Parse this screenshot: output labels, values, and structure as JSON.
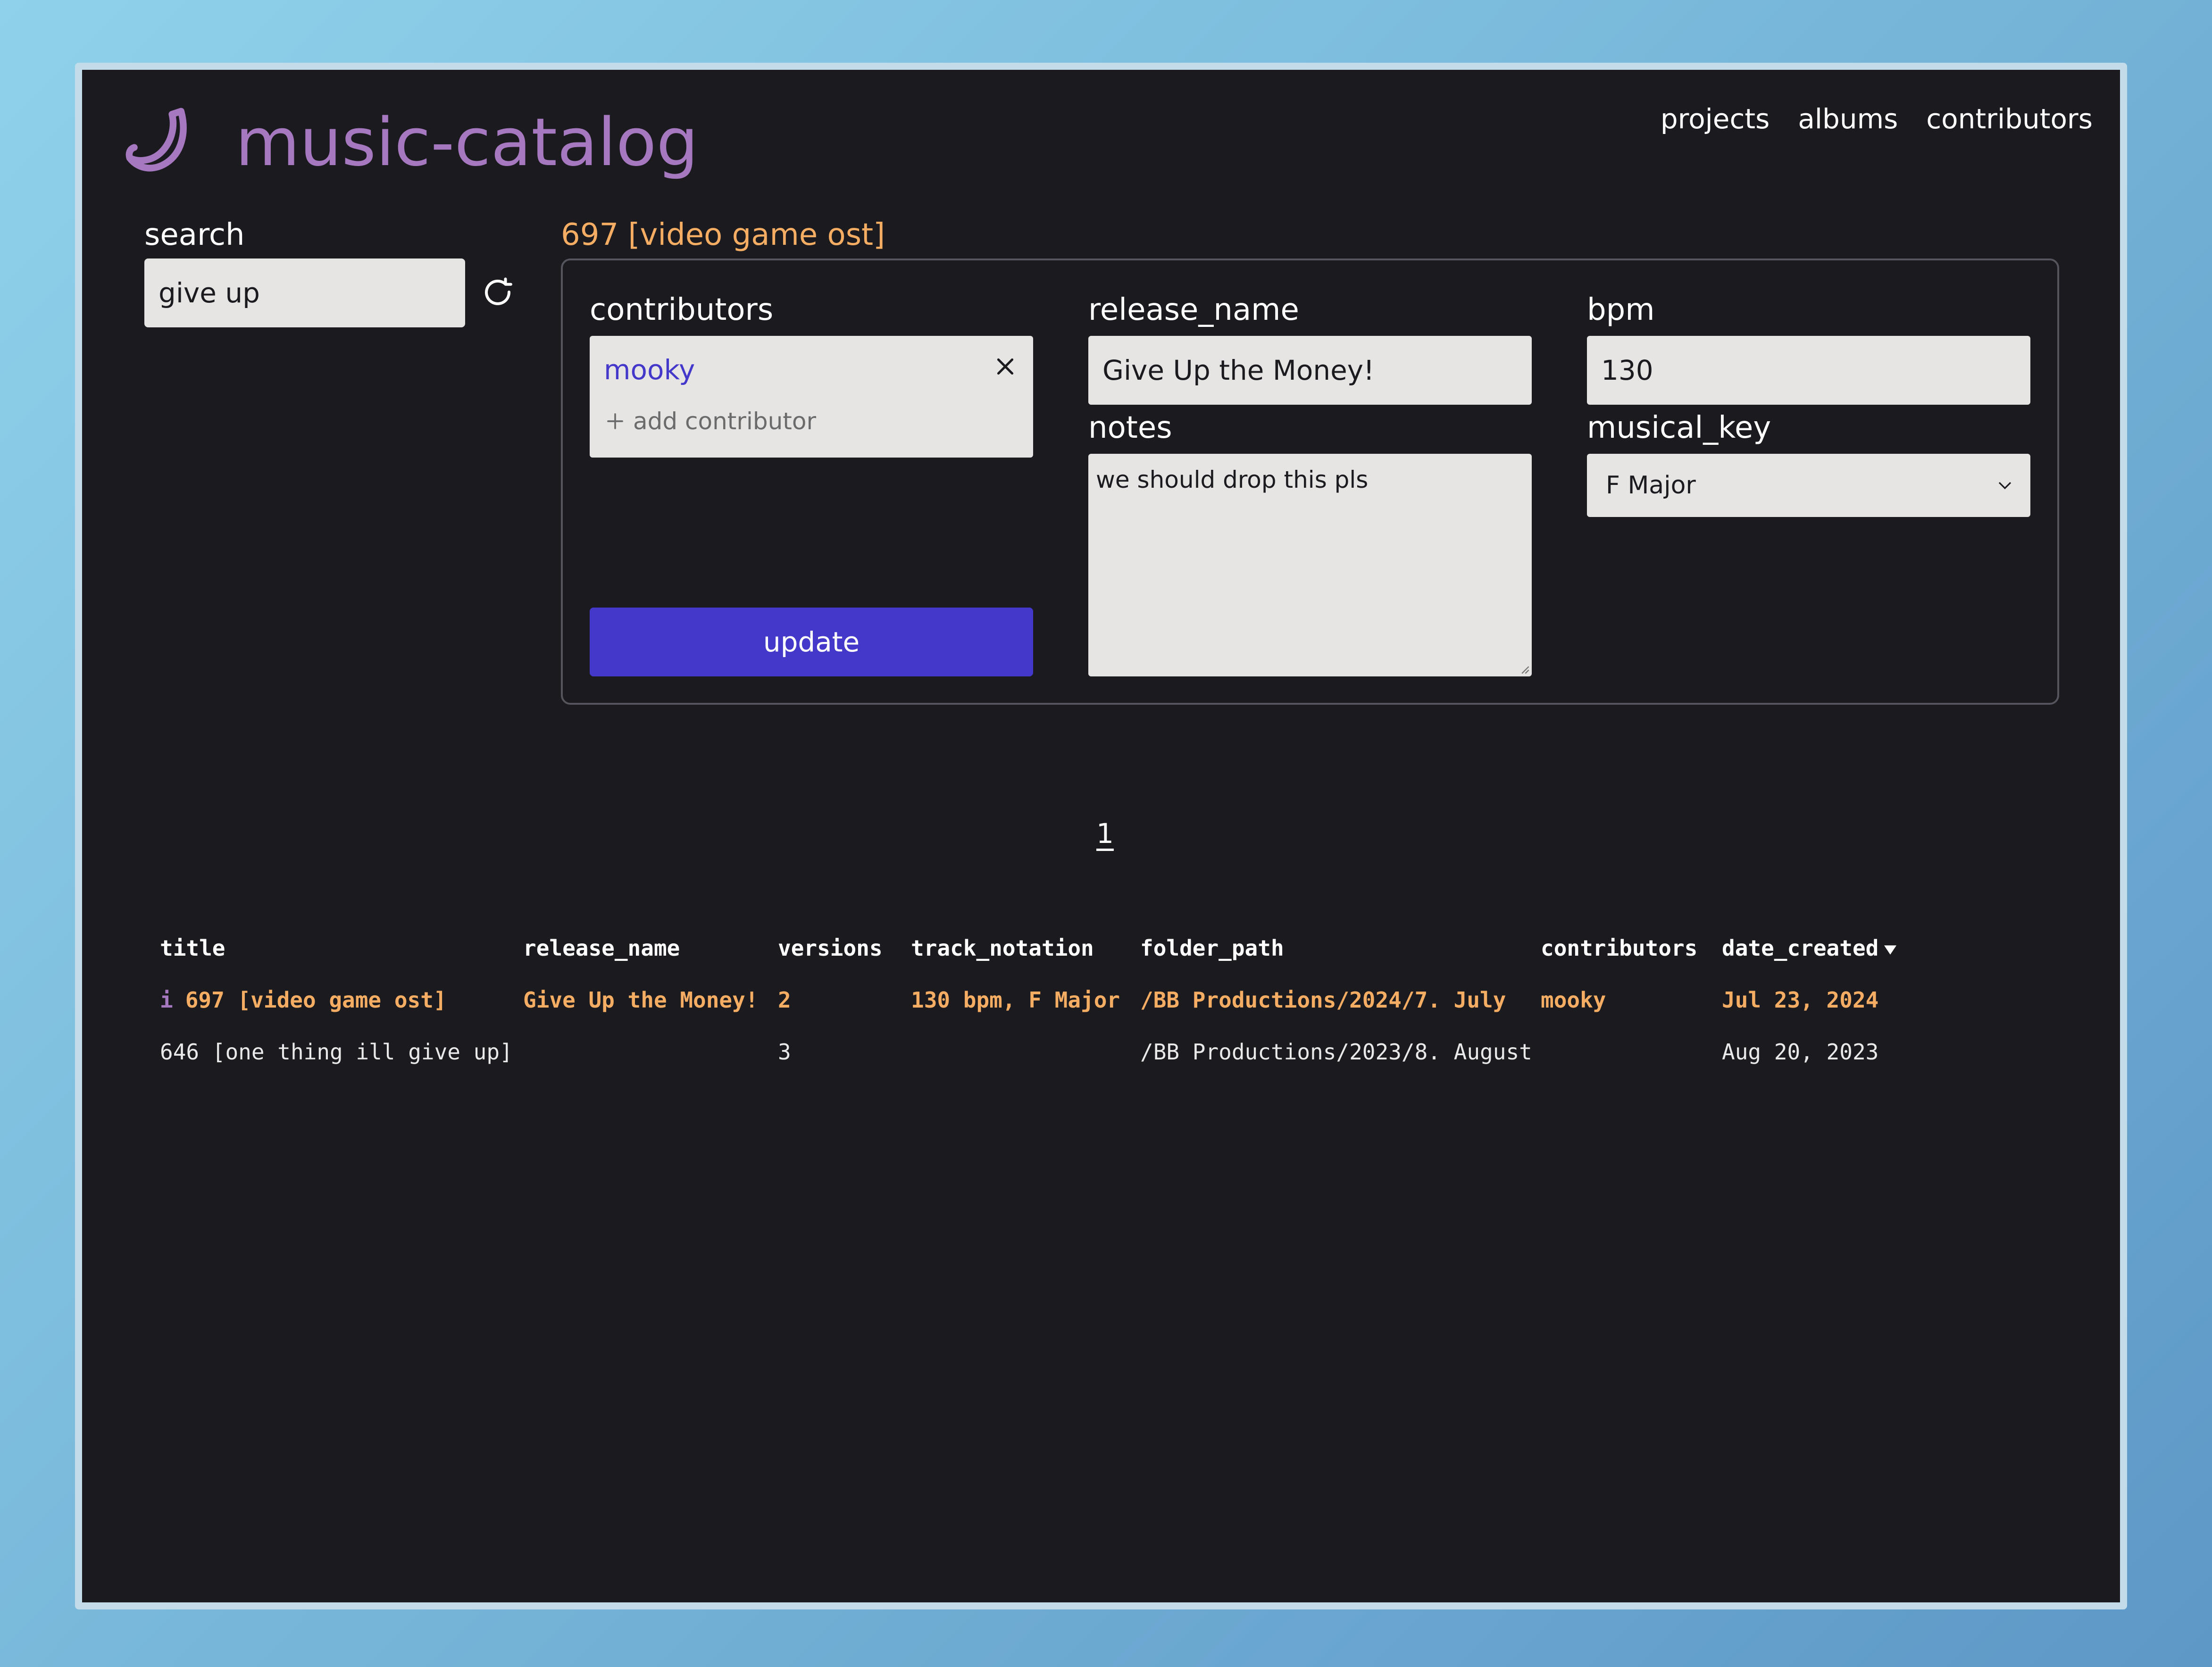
{
  "app": {
    "name": "music-catalog",
    "logo_icon": "banana-icon",
    "accent_color": "#a678c0"
  },
  "nav": [
    "projects",
    "albums",
    "contributors"
  ],
  "search": {
    "label": "search",
    "value": "give up",
    "refresh_icon": "refresh-icon"
  },
  "detail": {
    "title": "697 [video game ost]",
    "contributors_label": "contributors",
    "contributors": [
      "mooky"
    ],
    "add_contributor": "add contributor",
    "update_label": "update",
    "release_name_label": "release_name",
    "release_name": "Give Up the Money!",
    "notes_label": "notes",
    "notes": "we should drop this pls",
    "bpm_label": "bpm",
    "bpm": "130",
    "musical_key_label": "musical_key",
    "musical_key": "F Major"
  },
  "pagination": {
    "current": "1"
  },
  "table": {
    "columns": [
      "title",
      "release_name",
      "versions",
      "track_notation",
      "folder_path",
      "contributors",
      "date_created"
    ],
    "sorted_by": "date_created",
    "rows": [
      {
        "marker": "i",
        "title": "697 [video game ost]",
        "release_name": "Give Up the Money!",
        "versions": "2",
        "track_notation": "130 bpm, F Major",
        "folder_path": "/BB Productions/2024/7. July",
        "contributors": "mooky",
        "date_created": "Jul 23, 2024",
        "selected": true
      },
      {
        "marker": "",
        "title": "646 [one thing ill give up]",
        "release_name": "",
        "versions": "3",
        "track_notation": "",
        "folder_path": "/BB Productions/2023/8. August",
        "contributors": "",
        "date_created": "Aug 20, 2023",
        "selected": false
      }
    ]
  },
  "colors": {
    "background": "#1a1a1f",
    "highlight": "#f5ad63",
    "button": "#4338ca"
  }
}
